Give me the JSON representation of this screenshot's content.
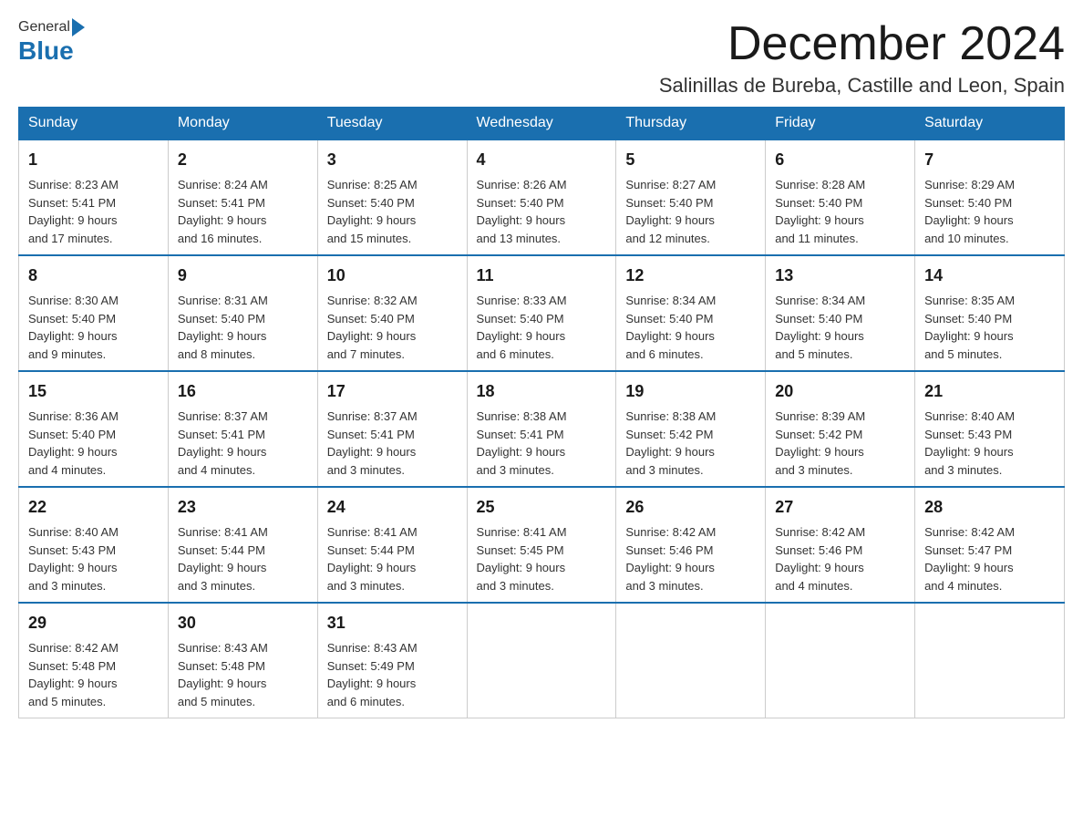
{
  "header": {
    "logo_general": "General",
    "logo_blue": "Blue",
    "month_title": "December 2024",
    "location": "Salinillas de Bureba, Castille and Leon, Spain"
  },
  "days_of_week": [
    "Sunday",
    "Monday",
    "Tuesday",
    "Wednesday",
    "Thursday",
    "Friday",
    "Saturday"
  ],
  "weeks": [
    [
      {
        "day": "1",
        "sunrise": "8:23 AM",
        "sunset": "5:41 PM",
        "daylight": "9 hours and 17 minutes."
      },
      {
        "day": "2",
        "sunrise": "8:24 AM",
        "sunset": "5:41 PM",
        "daylight": "9 hours and 16 minutes."
      },
      {
        "day": "3",
        "sunrise": "8:25 AM",
        "sunset": "5:40 PM",
        "daylight": "9 hours and 15 minutes."
      },
      {
        "day": "4",
        "sunrise": "8:26 AM",
        "sunset": "5:40 PM",
        "daylight": "9 hours and 13 minutes."
      },
      {
        "day": "5",
        "sunrise": "8:27 AM",
        "sunset": "5:40 PM",
        "daylight": "9 hours and 12 minutes."
      },
      {
        "day": "6",
        "sunrise": "8:28 AM",
        "sunset": "5:40 PM",
        "daylight": "9 hours and 11 minutes."
      },
      {
        "day": "7",
        "sunrise": "8:29 AM",
        "sunset": "5:40 PM",
        "daylight": "9 hours and 10 minutes."
      }
    ],
    [
      {
        "day": "8",
        "sunrise": "8:30 AM",
        "sunset": "5:40 PM",
        "daylight": "9 hours and 9 minutes."
      },
      {
        "day": "9",
        "sunrise": "8:31 AM",
        "sunset": "5:40 PM",
        "daylight": "9 hours and 8 minutes."
      },
      {
        "day": "10",
        "sunrise": "8:32 AM",
        "sunset": "5:40 PM",
        "daylight": "9 hours and 7 minutes."
      },
      {
        "day": "11",
        "sunrise": "8:33 AM",
        "sunset": "5:40 PM",
        "daylight": "9 hours and 6 minutes."
      },
      {
        "day": "12",
        "sunrise": "8:34 AM",
        "sunset": "5:40 PM",
        "daylight": "9 hours and 6 minutes."
      },
      {
        "day": "13",
        "sunrise": "8:34 AM",
        "sunset": "5:40 PM",
        "daylight": "9 hours and 5 minutes."
      },
      {
        "day": "14",
        "sunrise": "8:35 AM",
        "sunset": "5:40 PM",
        "daylight": "9 hours and 5 minutes."
      }
    ],
    [
      {
        "day": "15",
        "sunrise": "8:36 AM",
        "sunset": "5:40 PM",
        "daylight": "9 hours and 4 minutes."
      },
      {
        "day": "16",
        "sunrise": "8:37 AM",
        "sunset": "5:41 PM",
        "daylight": "9 hours and 4 minutes."
      },
      {
        "day": "17",
        "sunrise": "8:37 AM",
        "sunset": "5:41 PM",
        "daylight": "9 hours and 3 minutes."
      },
      {
        "day": "18",
        "sunrise": "8:38 AM",
        "sunset": "5:41 PM",
        "daylight": "9 hours and 3 minutes."
      },
      {
        "day": "19",
        "sunrise": "8:38 AM",
        "sunset": "5:42 PM",
        "daylight": "9 hours and 3 minutes."
      },
      {
        "day": "20",
        "sunrise": "8:39 AM",
        "sunset": "5:42 PM",
        "daylight": "9 hours and 3 minutes."
      },
      {
        "day": "21",
        "sunrise": "8:40 AM",
        "sunset": "5:43 PM",
        "daylight": "9 hours and 3 minutes."
      }
    ],
    [
      {
        "day": "22",
        "sunrise": "8:40 AM",
        "sunset": "5:43 PM",
        "daylight": "9 hours and 3 minutes."
      },
      {
        "day": "23",
        "sunrise": "8:41 AM",
        "sunset": "5:44 PM",
        "daylight": "9 hours and 3 minutes."
      },
      {
        "day": "24",
        "sunrise": "8:41 AM",
        "sunset": "5:44 PM",
        "daylight": "9 hours and 3 minutes."
      },
      {
        "day": "25",
        "sunrise": "8:41 AM",
        "sunset": "5:45 PM",
        "daylight": "9 hours and 3 minutes."
      },
      {
        "day": "26",
        "sunrise": "8:42 AM",
        "sunset": "5:46 PM",
        "daylight": "9 hours and 3 minutes."
      },
      {
        "day": "27",
        "sunrise": "8:42 AM",
        "sunset": "5:46 PM",
        "daylight": "9 hours and 4 minutes."
      },
      {
        "day": "28",
        "sunrise": "8:42 AM",
        "sunset": "5:47 PM",
        "daylight": "9 hours and 4 minutes."
      }
    ],
    [
      {
        "day": "29",
        "sunrise": "8:42 AM",
        "sunset": "5:48 PM",
        "daylight": "9 hours and 5 minutes."
      },
      {
        "day": "30",
        "sunrise": "8:43 AM",
        "sunset": "5:48 PM",
        "daylight": "9 hours and 5 minutes."
      },
      {
        "day": "31",
        "sunrise": "8:43 AM",
        "sunset": "5:49 PM",
        "daylight": "9 hours and 6 minutes."
      },
      null,
      null,
      null,
      null
    ]
  ],
  "labels": {
    "sunrise": "Sunrise:",
    "sunset": "Sunset:",
    "daylight": "Daylight:"
  }
}
